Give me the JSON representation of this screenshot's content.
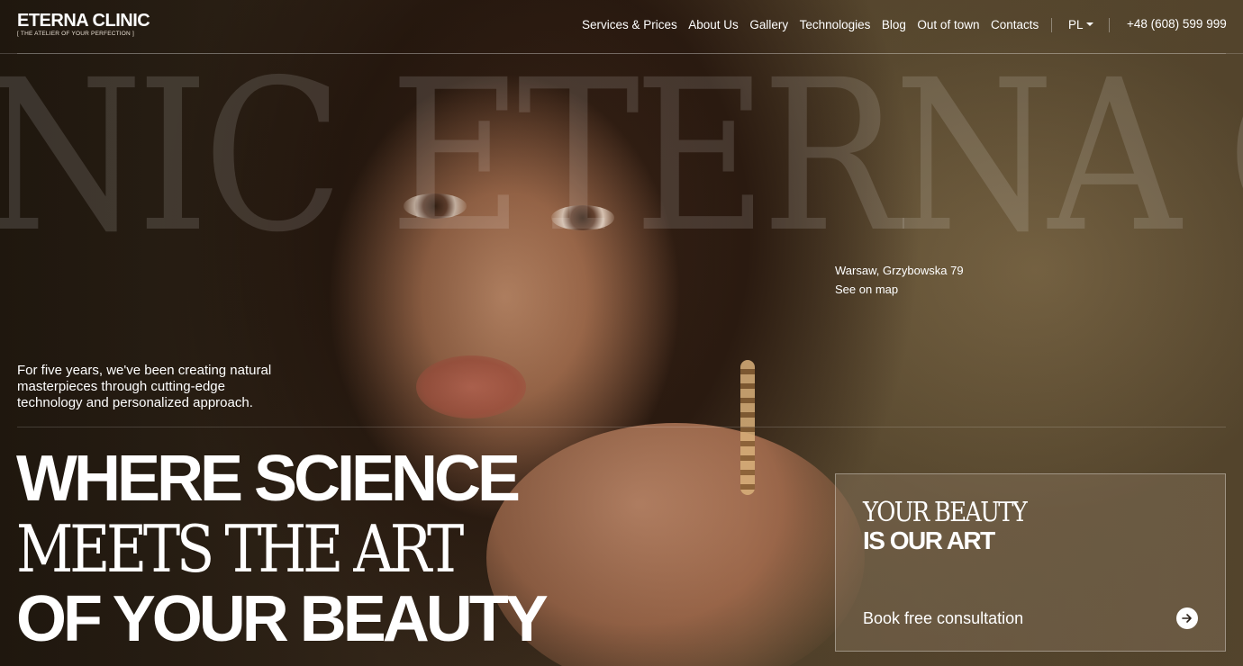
{
  "brand": {
    "name": "ETERNA CLINIC",
    "tagline": "[ THE ATELIER OF YOUR PERFECTION ]",
    "watermark": "NIC ETERNA CL"
  },
  "nav": {
    "items": [
      {
        "label": "Services & Prices"
      },
      {
        "label": "About Us"
      },
      {
        "label": "Gallery"
      },
      {
        "label": "Technologies"
      },
      {
        "label": "Blog"
      },
      {
        "label": "Out of town"
      },
      {
        "label": "Contacts"
      }
    ],
    "language": "PL",
    "phone": "+48 (608) 599 999"
  },
  "location": {
    "address": "Warsaw, Grzybowska 79",
    "map_link": "See on map"
  },
  "intro": {
    "text": "For five years, we've been creating natural masterpieces through cutting-edge technology and personalized approach."
  },
  "headline": {
    "line1": "WHERE SCIENCE",
    "line2": "MEETS THE ART",
    "line3": "OF YOUR BEAUTY"
  },
  "card": {
    "thin": "YOUR BEAUTY",
    "bold": "IS OUR ART",
    "cta": "Book free consultation"
  },
  "colors": {
    "text": "#ffffff",
    "background": "#3a2b1c"
  }
}
